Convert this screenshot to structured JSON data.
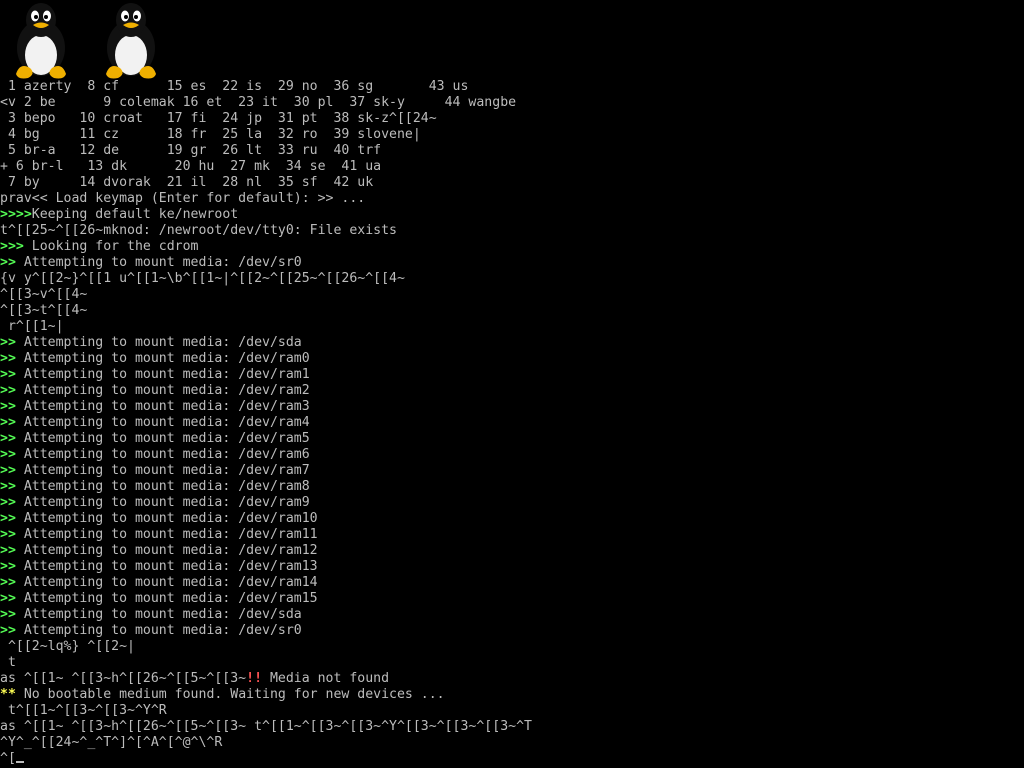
{
  "boot_logo": {
    "icon": "tux-penguin-icon",
    "count": 2
  },
  "colors": {
    "background": "#000000",
    "text": "#bcbcbc",
    "prompt_green": "#54fc54",
    "warn_yellow": "#fcfc54",
    "error_red": "#fc5454"
  },
  "console_lines": [
    {
      "prefix": "",
      "text": " 1 azerty  8 cf      15 es  22 is  29 no  36 sg       43 us"
    },
    {
      "prefix": "",
      "text": "<v 2 be      9 colemak 16 et  23 it  30 pl  37 sk-y     44 wangbe"
    },
    {
      "prefix": "",
      "text": " 3 bepo   10 croat   17 fi  24 jp  31 pt  38 sk-z^[[24~"
    },
    {
      "prefix": "",
      "text": " 4 bg     11 cz      18 fr  25 la  32 ro  39 slovene|"
    },
    {
      "prefix": "",
      "text": " 5 br-a   12 de      19 gr  26 lt  33 ru  40 trf"
    },
    {
      "prefix": "",
      "text": "+ 6 br-l   13 dk      20 hu  27 mk  34 se  41 ua"
    },
    {
      "prefix": "",
      "text": " 7 by     14 dvorak  21 il  28 nl  35 sf  42 uk"
    },
    {
      "prefix": "",
      "text": "prav<< Load keymap (Enter for default): >> ..."
    },
    {
      "prefix": ">>>>",
      "prefix_color": "green",
      "text": "Keeping default ke/newroot"
    },
    {
      "prefix": "",
      "text": "t^[[25~^[[26~mknod: /newroot/dev/tty0: File exists"
    },
    {
      "prefix": ">>>",
      "prefix_color": "green",
      "text": " Looking for the cdrom"
    },
    {
      "prefix": ">>",
      "prefix_color": "green",
      "text": " Attempting to mount media: /dev/sr0"
    },
    {
      "prefix": "",
      "text": "{v y^[[2~}^[[1 u^[[1~\\b^[[1~|^[[2~^[[25~^[[26~^[[4~"
    },
    {
      "prefix": "",
      "text": "^[[3~v^[[4~"
    },
    {
      "prefix": "",
      "text": "^[[3~t^[[4~"
    },
    {
      "prefix": "",
      "text": " r^[[1~|"
    },
    {
      "prefix": ">>",
      "prefix_color": "green",
      "text": " Attempting to mount media: /dev/sda"
    },
    {
      "prefix": ">>",
      "prefix_color": "green",
      "text": " Attempting to mount media: /dev/ram0"
    },
    {
      "prefix": ">>",
      "prefix_color": "green",
      "text": " Attempting to mount media: /dev/ram1"
    },
    {
      "prefix": ">>",
      "prefix_color": "green",
      "text": " Attempting to mount media: /dev/ram2"
    },
    {
      "prefix": ">>",
      "prefix_color": "green",
      "text": " Attempting to mount media: /dev/ram3"
    },
    {
      "prefix": ">>",
      "prefix_color": "green",
      "text": " Attempting to mount media: /dev/ram4"
    },
    {
      "prefix": ">>",
      "prefix_color": "green",
      "text": " Attempting to mount media: /dev/ram5"
    },
    {
      "prefix": ">>",
      "prefix_color": "green",
      "text": " Attempting to mount media: /dev/ram6"
    },
    {
      "prefix": ">>",
      "prefix_color": "green",
      "text": " Attempting to mount media: /dev/ram7"
    },
    {
      "prefix": ">>",
      "prefix_color": "green",
      "text": " Attempting to mount media: /dev/ram8"
    },
    {
      "prefix": ">>",
      "prefix_color": "green",
      "text": " Attempting to mount media: /dev/ram9"
    },
    {
      "prefix": ">>",
      "prefix_color": "green",
      "text": " Attempting to mount media: /dev/ram10"
    },
    {
      "prefix": ">>",
      "prefix_color": "green",
      "text": " Attempting to mount media: /dev/ram11"
    },
    {
      "prefix": ">>",
      "prefix_color": "green",
      "text": " Attempting to mount media: /dev/ram12"
    },
    {
      "prefix": ">>",
      "prefix_color": "green",
      "text": " Attempting to mount media: /dev/ram13"
    },
    {
      "prefix": ">>",
      "prefix_color": "green",
      "text": " Attempting to mount media: /dev/ram14"
    },
    {
      "prefix": ">>",
      "prefix_color": "green",
      "text": " Attempting to mount media: /dev/ram15"
    },
    {
      "prefix": ">>",
      "prefix_color": "green",
      "text": " Attempting to mount media: /dev/sda"
    },
    {
      "prefix": ">>",
      "prefix_color": "green",
      "text": " Attempting to mount media: /dev/sr0"
    },
    {
      "prefix": "",
      "text": " ^[[2~lq%} ^[[2~|"
    },
    {
      "prefix": "",
      "text": " t"
    },
    {
      "prefix": "",
      "text": "as ^[[1~ ^[[3~h^[[26~^[[5~^[[3~",
      "suffix_prefix": "!!",
      "suffix": " Media not found"
    },
    {
      "prefix": "**",
      "prefix_color": "yellow",
      "text": " No bootable medium found. Waiting for new devices ..."
    },
    {
      "prefix": "",
      "text": " t^[[1~^[[3~^[[3~^Y^R"
    },
    {
      "prefix": "",
      "text": "as ^[[1~ ^[[3~h^[[26~^[[5~^[[3~ t^[[1~^[[3~^[[3~^Y^[[3~^[[3~^[[3~^T"
    },
    {
      "prefix": "",
      "text": "^Y^_^[[24~^_^T^]^[^A^[^@^\\^R"
    },
    {
      "prefix": "",
      "text": "^[",
      "cursor": true
    }
  ]
}
